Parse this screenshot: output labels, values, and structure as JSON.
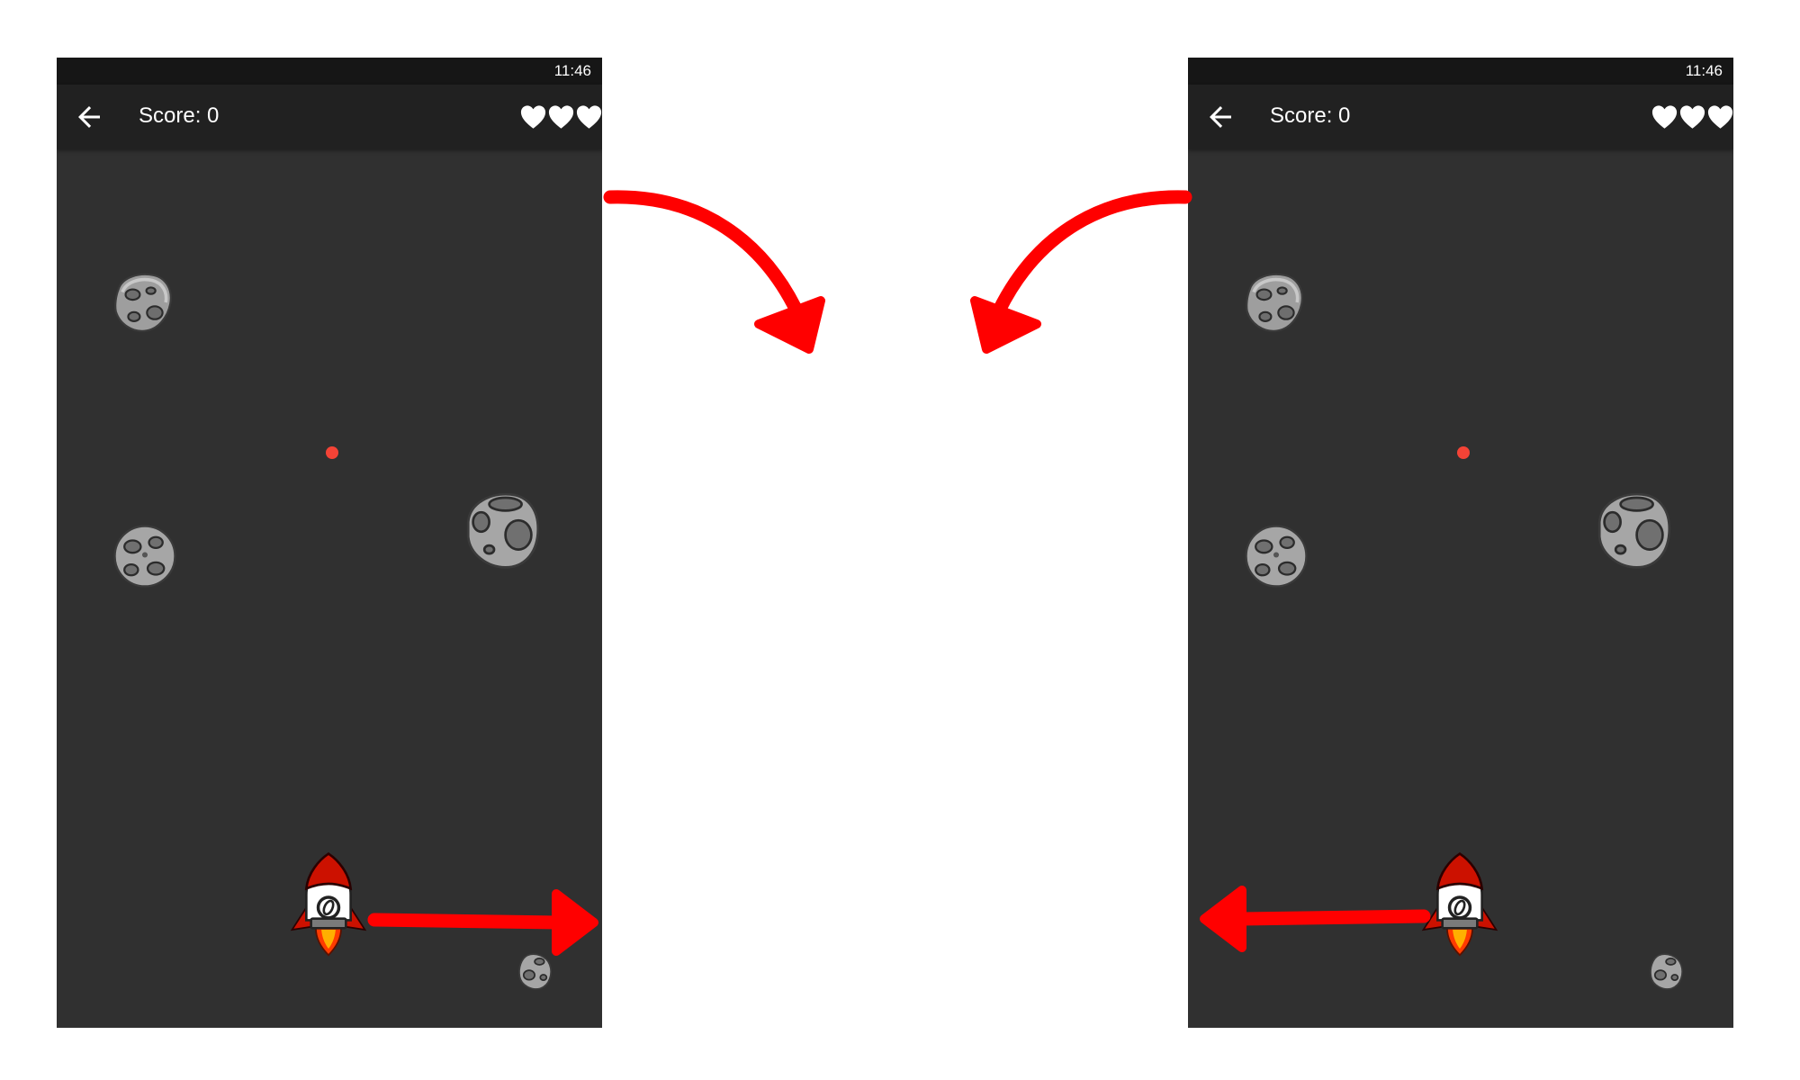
{
  "screens": [
    {
      "status_time": "11:46",
      "score_label": "Score: 0",
      "lives": 3,
      "player_direction": "right"
    },
    {
      "status_time": "11:46",
      "score_label": "Score: 0",
      "lives": 3,
      "player_direction": "left"
    }
  ],
  "icons": {
    "back": "arrow-left-icon",
    "life": "heart-icon",
    "asteroid": "asteroid-icon",
    "rocket": "rocket-icon",
    "bullet": "red-dot"
  },
  "colors": {
    "background": "#303030",
    "app_bar": "#212121",
    "status_bar": "#161616",
    "annotation_arrows": "#ff0000",
    "bullet": "#f44336",
    "rocket_red": "#cc1100"
  }
}
